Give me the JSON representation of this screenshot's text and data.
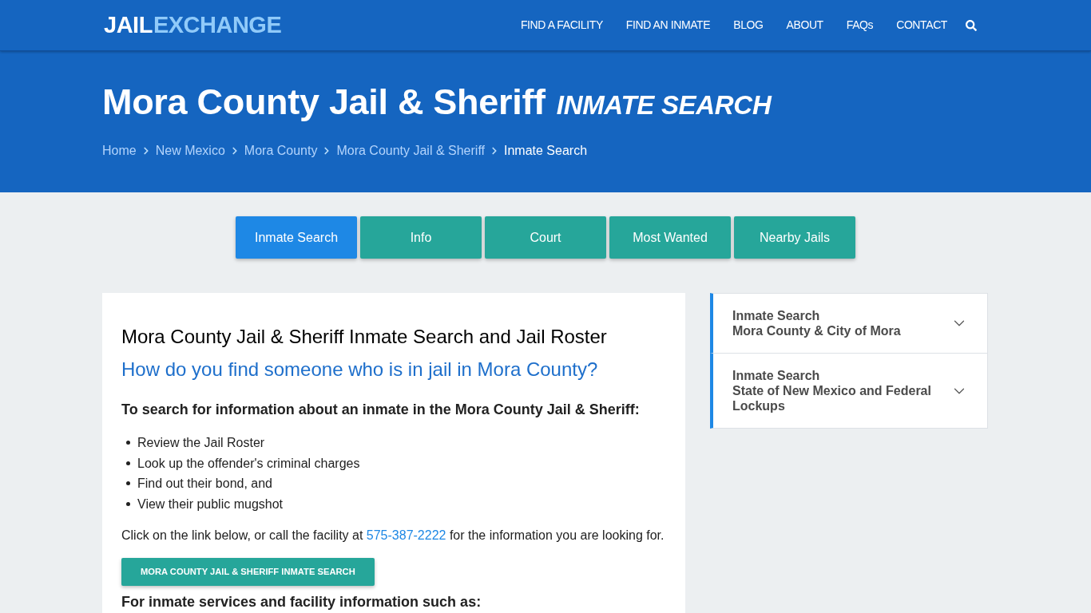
{
  "header": {
    "logo": [
      "JAIL",
      "EXCHANGE"
    ],
    "nav": [
      "FIND A FACILITY",
      "FIND AN INMATE",
      "BLOG",
      "ABOUT",
      "FAQs",
      "CONTACT"
    ]
  },
  "hero": {
    "title": "Mora County Jail & Sheriff",
    "subtitle": "INMATE SEARCH",
    "breadcrumb": [
      {
        "label": "Home",
        "current": false
      },
      {
        "label": "New Mexico",
        "current": false
      },
      {
        "label": "Mora County",
        "current": false
      },
      {
        "label": "Mora County Jail & Sheriff",
        "current": false
      },
      {
        "label": "Inmate Search",
        "current": true
      }
    ]
  },
  "tabs": [
    {
      "label": "Inmate Search",
      "selected": true
    },
    {
      "label": "Info",
      "selected": false
    },
    {
      "label": "Court",
      "selected": false
    },
    {
      "label": "Most Wanted",
      "selected": false
    },
    {
      "label": "Nearby Jails",
      "selected": false
    }
  ],
  "article": {
    "heading": "Mora County Jail & Sheriff Inmate Search and Jail Roster",
    "question": "How do you find someone who is in jail in Mora County?",
    "intro": "To search for information about an inmate in the Mora County Jail & Sheriff:",
    "list": [
      "Review the Jail Roster",
      "Look up the offender's criminal charges",
      "Find out their bond, and",
      "View their public mugshot"
    ],
    "call_before": "Click on the link below, or call the facility at",
    "phone": "575-387-2222",
    "call_after": "for the information you are looking for.",
    "button": "MORA COUNTY JAIL & SHERIFF INMATE SEARCH",
    "next_heading": "For inmate services and facility information such as:"
  },
  "sidebar": [
    {
      "title": "Inmate Search",
      "subtitle": "Mora County & City of Mora",
      "expanded": false
    },
    {
      "title": "Inmate Search",
      "subtitle": "State of New Mexico and Federal Lockups",
      "expanded": false
    }
  ]
}
